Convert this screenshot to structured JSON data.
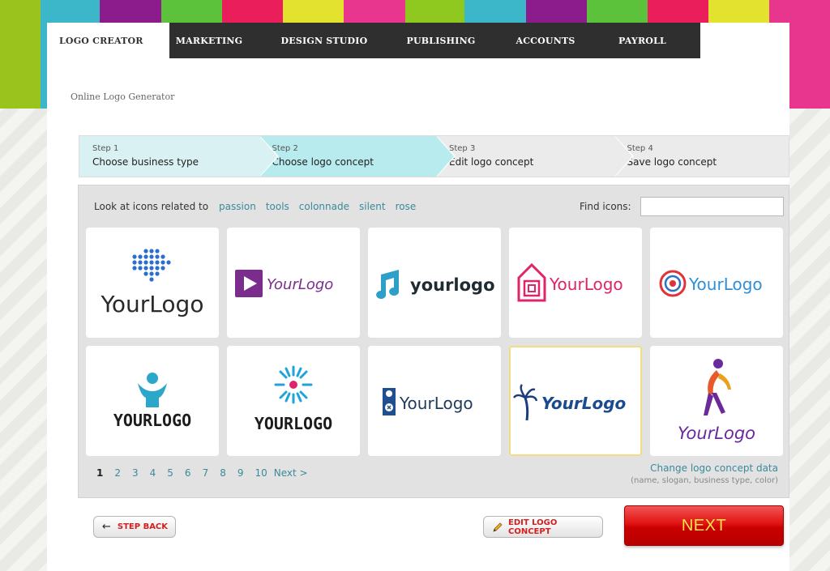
{
  "colors": {
    "stripes": [
      "#9bc31e",
      "#3bb7c9",
      "#8c1c8c",
      "#5cc23c",
      "#ea1e5a",
      "#e3e22f",
      "#e8368f",
      "#8fc81f",
      "#3bb7c9",
      "#8c1c8c",
      "#5cc23c",
      "#ea1e5a",
      "#e3e22f",
      "#e8368f"
    ],
    "accent_link": "#3a8a9a",
    "button_red": "#d21f1f",
    "next_text": "#ffe34a"
  },
  "nav": {
    "tabs": [
      {
        "label": "LOGO CREATOR",
        "active": true
      },
      {
        "label": "MARKETING",
        "active": false
      },
      {
        "label": "DESIGN STUDIO",
        "active": false
      },
      {
        "label": "PUBLISHING",
        "active": false
      },
      {
        "label": "ACCOUNTS",
        "active": false
      },
      {
        "label": "PAYROLL",
        "active": false
      }
    ]
  },
  "page": {
    "subtitle": "Online Logo Generator"
  },
  "steps": [
    {
      "num": "Step 1",
      "label": "Choose business type",
      "state": "done"
    },
    {
      "num": "Step 2",
      "label": "Choose logo concept",
      "state": "current"
    },
    {
      "num": "Step 3",
      "label": "Edit logo concept",
      "state": "todo"
    },
    {
      "num": "Step 4",
      "label": "Save logo concept",
      "state": "todo"
    }
  ],
  "related": {
    "lead": "Look at icons related to",
    "keywords": [
      "passion",
      "tools",
      "colonnade",
      "silent",
      "rose"
    ]
  },
  "find": {
    "label": "Find icons:",
    "value": "",
    "placeholder": ""
  },
  "logos": [
    {
      "text": "YourLogo",
      "icon": "dotted-arrow-icon",
      "selected": false
    },
    {
      "text": "YourLogo",
      "icon": "play-square-icon",
      "selected": false
    },
    {
      "text": "yourlogo",
      "icon": "music-note-icon",
      "selected": false
    },
    {
      "text": "YourLogo",
      "icon": "maze-house-icon",
      "selected": false
    },
    {
      "text": "YourLogo",
      "icon": "spiral-circle-icon",
      "selected": false
    },
    {
      "text": "YOURLOGO",
      "icon": "person-arms-up-icon",
      "selected": false
    },
    {
      "text": "YOURLOGO",
      "icon": "sunburst-icon",
      "selected": false
    },
    {
      "text": "YourLogo",
      "icon": "door-hanger-icon",
      "selected": false
    },
    {
      "text": "YourLogo",
      "icon": "palm-tree-icon",
      "selected": true
    },
    {
      "text": "YourLogo",
      "icon": "stretching-figure-icon",
      "selected": false
    }
  ],
  "pager": {
    "pages": [
      "1",
      "2",
      "3",
      "4",
      "5",
      "6",
      "7",
      "8",
      "9",
      "10"
    ],
    "current": "1",
    "next_label": "Next >"
  },
  "change": {
    "link": "Change logo concept data",
    "hint": "(name, slogan, business type, color)"
  },
  "buttons": {
    "back": "STEP BACK",
    "edit": "EDIT LOGO CONCEPT",
    "next": "NEXT"
  }
}
